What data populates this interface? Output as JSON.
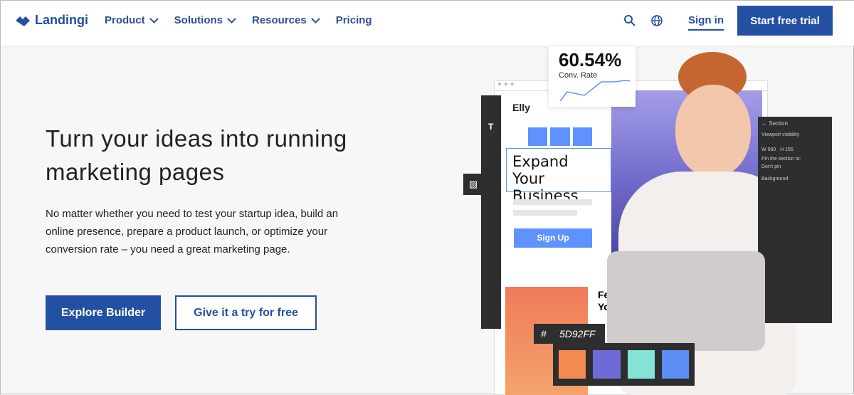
{
  "nav": {
    "logo": "Landingi",
    "items": [
      {
        "label": "Product"
      },
      {
        "label": "Solutions"
      },
      {
        "label": "Resources"
      },
      {
        "label": "Pricing"
      }
    ],
    "sign_in": "Sign in",
    "cta": "Start free trial"
  },
  "hero": {
    "title": "Turn your ideas into running marketing pages",
    "subtitle": "No matter whether you need to test your startup idea, build an online presence, prepare a product launch, or optimize your conversion rate – you need a great marketing page.",
    "primary_button": "Explore Builder",
    "secondary_button": "Give it a try for free"
  },
  "illustration": {
    "rate": "60.54%",
    "rate_label": "Conv. Rate",
    "brand": "Elly",
    "headline": "Expand Your Business",
    "signup": "Sign Up",
    "few": "Few",
    "you": "You",
    "hash": "#",
    "hex": "5D92FF",
    "swatches": [
      "#f28b50",
      "#6f6bd6",
      "#86e3d8",
      "#5b8ff5"
    ],
    "panel": {
      "title": "Section",
      "viewport": "Viewport visibility",
      "w_label": "W",
      "w": "960",
      "h_label": "H",
      "h": "155",
      "pin": "Pin the section to:",
      "pin_value": "Don't pin",
      "background": "Background"
    }
  },
  "colors": {
    "brand": "#2350a3",
    "accent": "#5d92ff"
  }
}
